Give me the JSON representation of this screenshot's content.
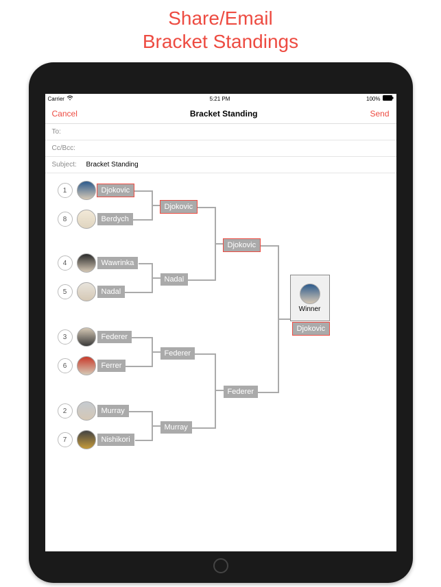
{
  "marketing": {
    "line1": "Share/Email",
    "line2": "Bracket Standings"
  },
  "status": {
    "carrier": "Carrier",
    "time": "5:21 PM",
    "battery": "100%"
  },
  "nav": {
    "cancel": "Cancel",
    "title": "Bracket Standing",
    "send": "Send"
  },
  "compose": {
    "to_label": "To:",
    "cc_label": "Cc/Bcc:",
    "subject_label": "Subject:",
    "subject_value": "Bracket Standing"
  },
  "colors": {
    "accent": "#ed4b41",
    "tag_bg": "#aaa"
  },
  "bracket": {
    "seeds": [
      {
        "rank": "1",
        "name": "Djokovic",
        "avatar": "djokovic",
        "highlight": true
      },
      {
        "rank": "8",
        "name": "Berdych",
        "avatar": "berdych",
        "highlight": false
      },
      {
        "rank": "4",
        "name": "Wawrinka",
        "avatar": "wawrinka",
        "highlight": false
      },
      {
        "rank": "5",
        "name": "Nadal",
        "avatar": "nadal",
        "highlight": false
      },
      {
        "rank": "3",
        "name": "Federer",
        "avatar": "federer",
        "highlight": false
      },
      {
        "rank": "6",
        "name": "Ferrer",
        "avatar": "ferrer",
        "highlight": false
      },
      {
        "rank": "2",
        "name": "Murray",
        "avatar": "murray",
        "highlight": false
      },
      {
        "rank": "7",
        "name": "Nishikori",
        "avatar": "nishikori",
        "highlight": false
      }
    ],
    "round2": [
      {
        "name": "Djokovic",
        "highlight": true
      },
      {
        "name": "Nadal",
        "highlight": false
      },
      {
        "name": "Federer",
        "highlight": false
      },
      {
        "name": "Murray",
        "highlight": false
      }
    ],
    "round3": [
      {
        "name": "Djokovic",
        "highlight": true
      },
      {
        "name": "Federer",
        "highlight": false
      }
    ],
    "winner": {
      "label": "Winner",
      "name": "Djokovic",
      "highlight": true
    }
  }
}
